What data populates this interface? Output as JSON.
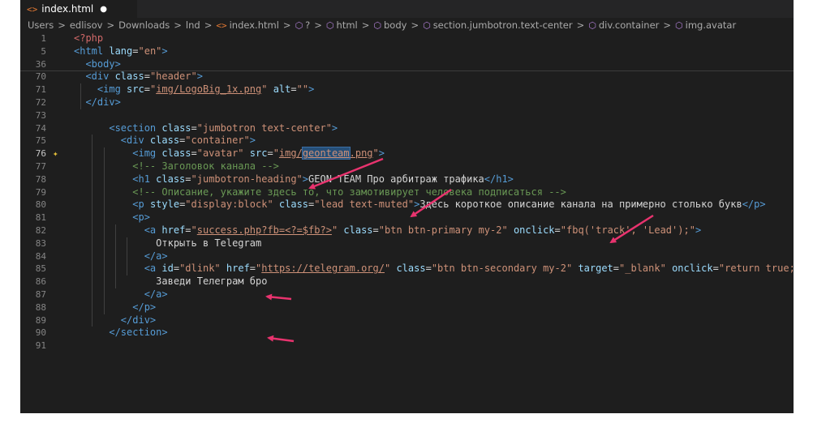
{
  "tab": {
    "icon": "<>",
    "label": "index.html",
    "dirty": "●"
  },
  "breadcrumb": {
    "items": [
      "Users",
      "edlisov",
      "Downloads",
      "lnd",
      "index.html",
      "?",
      "html",
      "body",
      "section.jumbotron.text-center",
      "div.container",
      "img.avatar"
    ],
    "separator": ">"
  },
  "code": {
    "lines": [
      {
        "n": "1",
        "tokens": [
          [
            "t",
            "<?php"
          ]
        ]
      },
      {
        "n": "5",
        "tokens": [
          [
            "t",
            "<html "
          ],
          [
            "a",
            "lang"
          ],
          [
            "d",
            "="
          ],
          [
            "s",
            "\"en\""
          ],
          [
            "t",
            ">"
          ]
        ]
      },
      {
        "n": "36",
        "tokens": [
          [
            "d",
            "  "
          ],
          [
            "t",
            "<body>"
          ]
        ]
      },
      {
        "n": "70",
        "tokens": [
          [
            "d",
            "  "
          ],
          [
            "t",
            "<div "
          ],
          [
            "a",
            "class"
          ],
          [
            "d",
            "="
          ],
          [
            "s",
            "\"header\""
          ],
          [
            "t",
            ">"
          ]
        ]
      },
      {
        "n": "71",
        "tokens": [
          [
            "d",
            "    "
          ],
          [
            "t",
            "<img "
          ],
          [
            "a",
            "src"
          ],
          [
            "d",
            "="
          ],
          [
            "s",
            "\""
          ],
          [
            "su",
            "img/LogoBig_1x.png"
          ],
          [
            "s",
            "\""
          ],
          [
            "d",
            " "
          ],
          [
            "a",
            "alt"
          ],
          [
            "d",
            "="
          ],
          [
            "s",
            "\"\""
          ],
          [
            "t",
            ">"
          ]
        ]
      },
      {
        "n": "72",
        "tokens": [
          [
            "d",
            "  "
          ],
          [
            "t",
            "</div>"
          ]
        ]
      },
      {
        "n": "73",
        "tokens": []
      },
      {
        "n": "74",
        "tokens": [
          [
            "d",
            "      "
          ],
          [
            "t",
            "<section "
          ],
          [
            "a",
            "class"
          ],
          [
            "d",
            "="
          ],
          [
            "s",
            "\"jumbotron text-center\""
          ],
          [
            "t",
            ">"
          ]
        ]
      },
      {
        "n": "75",
        "tokens": [
          [
            "d",
            "        "
          ],
          [
            "t",
            "<div "
          ],
          [
            "a",
            "class"
          ],
          [
            "d",
            "="
          ],
          [
            "s",
            "\"container\""
          ],
          [
            "t",
            ">"
          ]
        ]
      },
      {
        "n": "76",
        "tokens": [
          [
            "d",
            "          "
          ],
          [
            "t",
            "<img "
          ],
          [
            "a",
            "class"
          ],
          [
            "d",
            "="
          ],
          [
            "s",
            "\"avatar\""
          ],
          [
            "d",
            " "
          ],
          [
            "a",
            "src"
          ],
          [
            "d",
            "="
          ],
          [
            "s",
            "\""
          ],
          [
            "su",
            "img/"
          ],
          [
            "sel",
            "geonteam"
          ],
          [
            "su",
            ".png"
          ],
          [
            "s",
            "\""
          ],
          [
            "t",
            ">"
          ]
        ]
      },
      {
        "n": "77",
        "tokens": [
          [
            "d",
            "          "
          ],
          [
            "c",
            "<!-- Заголовок канала -->"
          ]
        ]
      },
      {
        "n": "78",
        "tokens": [
          [
            "d",
            "          "
          ],
          [
            "t",
            "<h1 "
          ],
          [
            "a",
            "class"
          ],
          [
            "d",
            "="
          ],
          [
            "s",
            "\"jumbotron-heading\""
          ],
          [
            "t",
            ">"
          ],
          [
            "d",
            "GEON TEAM Про арбитраж трафика"
          ],
          [
            "t",
            "</h1>"
          ]
        ]
      },
      {
        "n": "79",
        "tokens": [
          [
            "d",
            "          "
          ],
          [
            "c",
            "<!-- Описание, укажите здесь то, что замотивирует человека подписаться -->"
          ]
        ]
      },
      {
        "n": "80",
        "tokens": [
          [
            "d",
            "          "
          ],
          [
            "t",
            "<p "
          ],
          [
            "a",
            "style"
          ],
          [
            "d",
            "="
          ],
          [
            "s",
            "\"display:block\""
          ],
          [
            "d",
            " "
          ],
          [
            "a",
            "class"
          ],
          [
            "d",
            "="
          ],
          [
            "s",
            "\"lead text-muted\""
          ],
          [
            "t",
            ">"
          ],
          [
            "d",
            "Здесь короткое описание канала на примерно столько букв"
          ],
          [
            "t",
            "</p>"
          ]
        ]
      },
      {
        "n": "81",
        "tokens": [
          [
            "d",
            "          "
          ],
          [
            "t",
            "<p>"
          ]
        ]
      },
      {
        "n": "82",
        "tokens": [
          [
            "d",
            "            "
          ],
          [
            "t",
            "<a "
          ],
          [
            "a",
            "href"
          ],
          [
            "d",
            "="
          ],
          [
            "s",
            "\""
          ],
          [
            "su",
            "success.php?fb=<?=$fb?>"
          ],
          [
            "s",
            "\""
          ],
          [
            "d",
            " "
          ],
          [
            "a",
            "class"
          ],
          [
            "d",
            "="
          ],
          [
            "s",
            "\"btn btn-primary my-2\""
          ],
          [
            "d",
            " "
          ],
          [
            "a",
            "onclick"
          ],
          [
            "d",
            "="
          ],
          [
            "s",
            "\"fbq('track', 'Lead');\""
          ],
          [
            "t",
            ">"
          ]
        ]
      },
      {
        "n": "83",
        "tokens": [
          [
            "d",
            "              Открыть в Telegram"
          ]
        ]
      },
      {
        "n": "84",
        "tokens": [
          [
            "d",
            "            "
          ],
          [
            "t",
            "</a>"
          ]
        ]
      },
      {
        "n": "85",
        "tokens": [
          [
            "d",
            "            "
          ],
          [
            "t",
            "<a "
          ],
          [
            "a",
            "id"
          ],
          [
            "d",
            "="
          ],
          [
            "s",
            "\"dlink\""
          ],
          [
            "d",
            " "
          ],
          [
            "a",
            "href"
          ],
          [
            "d",
            "="
          ],
          [
            "s",
            "\""
          ],
          [
            "su",
            "https://telegram.org/"
          ],
          [
            "s",
            "\""
          ],
          [
            "d",
            " "
          ],
          [
            "a",
            "class"
          ],
          [
            "d",
            "="
          ],
          [
            "s",
            "\"btn btn-secondary my-2\""
          ],
          [
            "d",
            " "
          ],
          [
            "a",
            "target"
          ],
          [
            "d",
            "="
          ],
          [
            "s",
            "\"_blank\""
          ],
          [
            "d",
            " "
          ],
          [
            "a",
            "onclick"
          ],
          [
            "d",
            "="
          ],
          [
            "s",
            "\"return true;\""
          ],
          [
            "t",
            ">"
          ]
        ]
      },
      {
        "n": "86",
        "tokens": [
          [
            "d",
            "              Заведи Телеграм бро"
          ]
        ]
      },
      {
        "n": "87",
        "tokens": [
          [
            "d",
            "            "
          ],
          [
            "t",
            "</a>"
          ]
        ]
      },
      {
        "n": "88",
        "tokens": [
          [
            "d",
            "          "
          ],
          [
            "t",
            "</p>"
          ]
        ]
      },
      {
        "n": "89",
        "tokens": [
          [
            "d",
            "        "
          ],
          [
            "t",
            "</div>"
          ]
        ]
      },
      {
        "n": "90",
        "tokens": [
          [
            "d",
            "      "
          ],
          [
            "t",
            "</section>"
          ]
        ]
      },
      {
        "n": "91",
        "tokens": []
      }
    ],
    "active_line": "76"
  },
  "colors": {
    "background": "#1e1e1e",
    "tag": "#569cd6",
    "attribute": "#9cdcfe",
    "string": "#ce9178",
    "comment": "#6a9955",
    "annotation_arrow": "#e8336e",
    "sparkle": "#e6c03a"
  },
  "icons": {
    "sparkle": "sparkle-icon",
    "breadcrumb_symbol": "cube-icon",
    "html_file": "html-file-icon"
  }
}
